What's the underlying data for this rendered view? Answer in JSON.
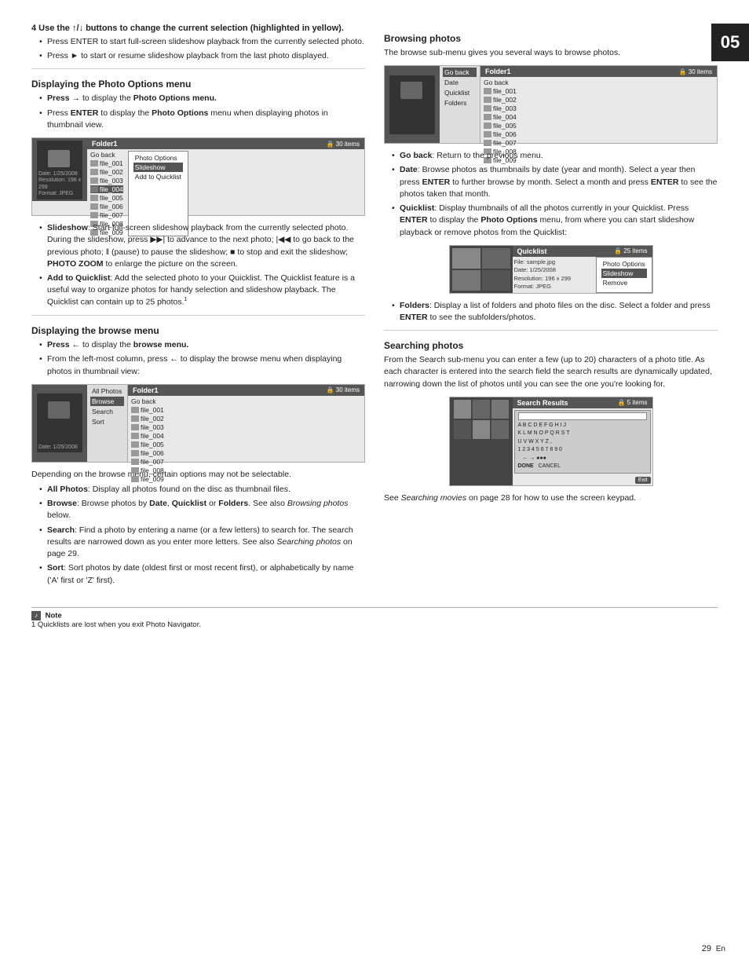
{
  "page": {
    "chapter": "05",
    "page_number": "29",
    "page_lang": "En"
  },
  "main_intro": {
    "step_label": "4  Use the ↑/↓ buttons to change the current selection (highlighted in yellow).",
    "bullets": [
      "Press ENTER to start full-screen slideshow playback from the currently selected photo.",
      "Press ► to start or resume slideshow playback from the last photo displayed."
    ]
  },
  "photo_options_section": {
    "heading": "Displaying the Photo Options menu",
    "bullets": [
      "Press → to display the Photo Options menu.",
      "Press ENTER to display the Photo Options menu when displaying photos in thumbnail view."
    ],
    "screen1": {
      "folder": "Folder1",
      "items": "30 items",
      "files": [
        "Go back",
        "file_001",
        "file_002",
        "file_003",
        "file_004",
        "file_005",
        "file_006",
        "file_007",
        "file_008",
        "file_009"
      ],
      "left_info": "Date: 1/25/2008\nResolution: 196 x 299\nFormat: JPEG",
      "menu_items": [
        "Photo Options",
        "Slideshow",
        "Add to Quicklist"
      ],
      "menu_selected": "Slideshow"
    },
    "description_bullets": [
      "Slideshow: Start full-screen slideshow playback from the currently selected photo. During the slideshow, press ►► to advance to the next photo; |◄◄ to go back to the previous photo; ‖ (pause) to pause the slideshow; ■ to stop and exit the slideshow; PHOTO ZOOM to enlarge the picture on the screen.",
      "Add to Quicklist: Add the selected photo to your Quicklist. The Quicklist feature is a useful way to organize photos for handy selection and slideshow playback. The Quicklist can contain up to 25 photos.¹"
    ]
  },
  "browse_menu_section": {
    "heading": "Displaying the browse menu",
    "bullets": [
      "Press ← to display the browse menu.",
      "From the left-most column, press ← to display the browse menu when displaying photos in thumbnail view:"
    ],
    "screen2": {
      "folder": "Folder1",
      "items": "30 items",
      "files": [
        "Go back",
        "file_001",
        "file_002",
        "file_003",
        "file_004",
        "file_005",
        "file_006",
        "file_007",
        "file_008",
        "file_009"
      ],
      "left_panel": [
        "All Photos",
        "Browse",
        "Search",
        "Sort"
      ],
      "left_selected": "Browse"
    },
    "desc_text": "Depending on the browse menu, certain options may not be selectable.",
    "desc_bullets": [
      "All Photos: Display all photos found on the disc as thumbnail files.",
      "Browse: Browse photos by Date, Quicklist or Folders. See also Browsing photos below.",
      "Search: Find a photo by entering a name (or a few letters) to search for. The search results are narrowed down as you enter more letters. See also Searching photos on page 29.",
      "Sort: Sort photos by date (oldest first or most recent first), or alphabetically by name ('A' first or 'Z' first)."
    ]
  },
  "browsing_photos_section": {
    "heading": "Browsing photos",
    "intro": "The browse sub-menu gives you several ways to browse photos.",
    "screen3": {
      "folder": "Folder1",
      "items": "30 items",
      "files": [
        "Go back",
        "file_001",
        "file_002",
        "file_003",
        "file_004",
        "file_005",
        "file_006",
        "file_007",
        "file_008",
        "file_009"
      ],
      "left_panel": [
        "Go back",
        "Date",
        "Quicklist",
        "Folders"
      ],
      "left_selected": "Go back"
    },
    "desc_bullets": [
      "Go back: Return to the previous menu.",
      "Date: Browse photos as thumbnails by date (year and month). Select a year then press ENTER to further browse by month. Select a month and press ENTER to see the photos taken that month.",
      "Quicklist: Display thumbnails of all the photos currently in your Quicklist. Press ENTER to display the Photo Options menu, from where you can start slideshow playback or remove photos from the Quicklist:"
    ],
    "screen_ql": {
      "folder": "Quicklist",
      "items": "25 items",
      "file_info": "File: sample.jpg\nDate: 1/25/2008\nResolution: 196 x 299\nFormat: JPEG",
      "menu_items": [
        "Photo Options",
        "Slideshow",
        "Remove"
      ],
      "menu_selected": "Slideshow"
    },
    "folders_bullet": "Folders: Display a list of folders and photo files on the disc. Select a folder and press ENTER to see the subfolders/photos."
  },
  "searching_photos_section": {
    "heading": "Searching photos",
    "intro": "From the Search sub-menu you can enter a few (up to 20) characters of a photo title. As each character is entered into the search field the search results are dynamically updated, narrowing down the list of photos until you can see the one you're looking for.",
    "screen_search": {
      "folder": "Search Results",
      "items": "5 items",
      "keypad_rows": [
        "A B C D E F G H I J",
        "K L M N O P Q R S T",
        "U V W X Y Z ,",
        "1 2 3 4 5 6 7 8 9 0",
        "  ← → ●●●",
        "DONE  CANCEL"
      ]
    },
    "footer_text": "See Searching movies on page 28 for how to use the screen keypad."
  },
  "note": {
    "label": "Note",
    "items": [
      "1 Quicklists are lost when you exit Photo Navigator."
    ]
  }
}
